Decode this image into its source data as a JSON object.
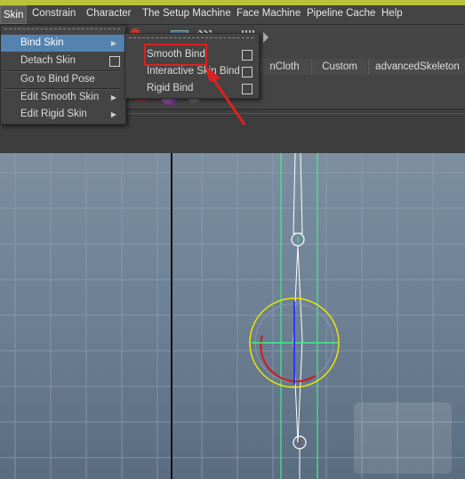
{
  "menubar": {
    "items": [
      "Skin",
      "Constrain",
      "Character",
      "The Setup Machine",
      "Face Machine",
      "Pipeline Cache",
      "Help"
    ]
  },
  "skin_menu": {
    "items": [
      {
        "label": "Bind Skin",
        "has_submenu": true,
        "option_box": false
      },
      {
        "label": "Detach Skin",
        "has_submenu": false,
        "option_box": true
      },
      {
        "label": "Go to Bind Pose",
        "has_submenu": false,
        "option_box": false
      },
      {
        "label": "Edit Smooth Skin",
        "has_submenu": true,
        "option_box": false
      },
      {
        "label": "Edit Rigid Skin",
        "has_submenu": true,
        "option_box": false
      }
    ]
  },
  "bind_skin_submenu": {
    "items": [
      {
        "label": "Smooth Bind",
        "option_box": true
      },
      {
        "label": "Interactive Skin Bind",
        "option_box": true
      },
      {
        "label": "Rigid Bind",
        "option_box": true
      }
    ]
  },
  "shelf_tabs": [
    "nCloth",
    "Custom",
    "advancedSkeleton"
  ],
  "colors": {
    "menu_highlight": "#5483b0",
    "annotation_red": "#e02020",
    "viewport_top": "#7c8fa1",
    "viewport_bottom": "#5a6c80",
    "joint_green": "#3df08a",
    "control_yellow": "#e8e800"
  },
  "icons": [
    "submenu-arrow-icon",
    "option-box-icon",
    "annotation-arrow-icon"
  ]
}
